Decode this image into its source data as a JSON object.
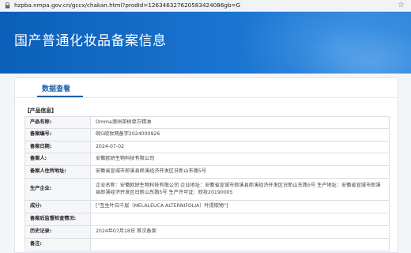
{
  "browser": {
    "url": "hzpba.nmpa.gov.cn/gccx/chakan.html?prodId=126346327620583424086gb=G"
  },
  "banner": {
    "title": "国产普通化妆品备案信息"
  },
  "card": {
    "tab_label": "数据查看",
    "section_title": "【产品信息】",
    "rows": [
      {
        "label": "产品名称:",
        "value": "Omma澳洲茶树单方精油"
      },
      {
        "label": "备案编号:",
        "value": "皖G皖妆网备字2024000926"
      },
      {
        "label": "备案日期:",
        "value": "2024-07-02"
      },
      {
        "label": "备案人:",
        "value": "安徽欧妍生物科技有限公司"
      },
      {
        "label": "备案人住所地址:",
        "value": "安徽省宣城市郎溪县郎溪经济开发区日新山东路5号"
      },
      {
        "label": "生产企业:",
        "value": "企业名称：安徽欧妍生物科技有限公司 企业地址：安徽省宣城市郎溪县郎溪经济开发区日新山东路5号 生产地址：安徽省宣城市郎溪县郎溪经济开发区日新山东路5号 生产许可证：皖妆20190005"
      },
      {
        "label": "成分:",
        "value": "[\"互生叶白千层（MELALEUCA ALTERNIFOLIA）叶提取物\"]"
      },
      {
        "label": "备案后监督检查情况:",
        "value": ""
      },
      {
        "label": "历史记录:",
        "value": "2024年07月18日 首次备案"
      },
      {
        "label": "备注:",
        "value": ""
      }
    ]
  }
}
